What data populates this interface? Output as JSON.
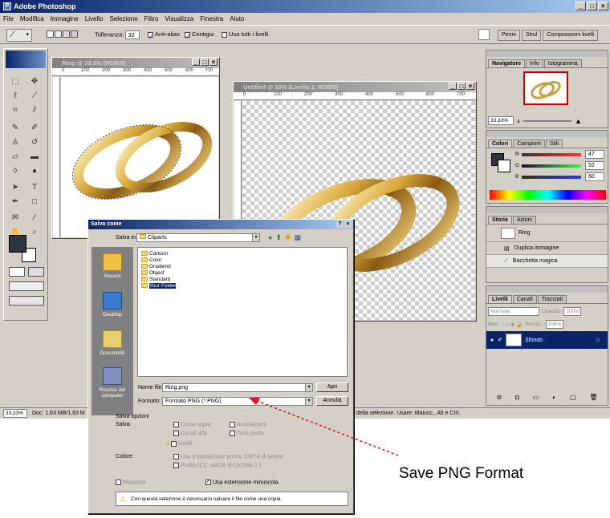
{
  "app": {
    "title": "Adobe Photoshop",
    "menu": [
      "File",
      "Modifica",
      "Immagine",
      "Livello",
      "Selezione",
      "Filtro",
      "Visualizza",
      "Finestra",
      "Aiuto"
    ],
    "options": {
      "tolerance_label": "Tolleranza:",
      "tolerance_value": "32",
      "antialias": "Anti-alias",
      "contiguous": "Contigui",
      "all_layers": "Usa tutti i livelli"
    },
    "palette_well": [
      "Penni",
      "Strul",
      "Composizioni livelli"
    ],
    "status": {
      "zoom": "33,33%",
      "doc": "Doc: 1,63 MB/1,63 M",
      "hint": "della selezione. Usare: Maiusc., Alt e Ctrl."
    }
  },
  "windows": {
    "ring": {
      "title": "Ring @ 33,3% (RGB/8)",
      "ruler": [
        "0",
        "100",
        "200",
        "300",
        "400",
        "500",
        "600",
        "700"
      ]
    },
    "untitled": {
      "title": "Untitled @ 50% (Livello 1, RGB/8)",
      "ruler": [
        "0",
        "100",
        "200",
        "300",
        "400",
        "500",
        "600",
        "700"
      ]
    }
  },
  "panels": {
    "navigator": {
      "tabs": [
        "Navigatore",
        "Info",
        "Istogramma"
      ],
      "zoom": "33,33%"
    },
    "color": {
      "tabs": [
        "Colori",
        "Campioni",
        "Stili"
      ],
      "r": "47",
      "g": "52",
      "b": "60",
      "r_label": "R",
      "g_label": "G",
      "b_label": "B"
    },
    "history": {
      "tabs": [
        "Storia",
        "Azioni"
      ],
      "items": [
        "Ring",
        "Duplica immagine",
        "Bacchetta magica"
      ]
    },
    "layers": {
      "tabs": [
        "Livelli",
        "Canali",
        "Tracciati"
      ],
      "mode": "Normale",
      "opacity_label": "Opacità:",
      "opacity": "100%",
      "lock_label": "Bloc.:",
      "fill_label": "Riemp.:",
      "fill": "100%",
      "layer_name": "Sfondo"
    }
  },
  "dialog": {
    "title": "Salva come",
    "save_in_label": "Salva in:",
    "save_in_value": "Cliparts",
    "places": [
      "Recent",
      "Desktop",
      "Documenti",
      "Risorse del computer"
    ],
    "folders": [
      "Cartoon",
      "Color",
      "Gradiend",
      "Object",
      "Standard",
      "Your Folder"
    ],
    "filename_label": "Nome file:",
    "filename_value": "Ring.png",
    "format_label": "Formato:",
    "format_value": "Formato PNG (*.PNG)",
    "open_btn": "Apri",
    "cancel_btn": "Annulla",
    "save_options_title": "Salva opzioni",
    "save_label": "Salva:",
    "as_copy": "Come copia",
    "annotations": "Annotazioni",
    "alpha_channels": "Canali alfa",
    "spot_colors": "Tinte piatte",
    "layers": "Livelli",
    "color_label": "Colore:",
    "use_proof": "Usa impostazione prova: CMYK di lavoro",
    "icc_profile": "Profilo ICC: sRGB IEC61966-2.1",
    "thumbnail": "Miniatura",
    "lowercase_ext": "Usa estensione minuscola",
    "warning": "Con questa selezione è necessario salvare il file come una copia."
  },
  "annotation": {
    "text": "Save PNG Format",
    "color": "#e8141c"
  }
}
